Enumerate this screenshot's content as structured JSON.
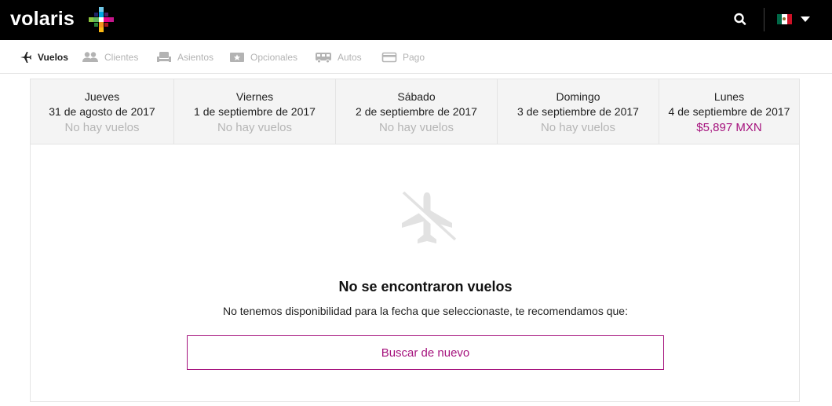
{
  "header": {
    "logo_text": "volaris",
    "icons": {
      "search": "search-icon",
      "flag": "mexico-flag-icon",
      "caret": "chevron-down-icon"
    },
    "colors": {
      "background": "#000000",
      "logo_text": "#ffffff"
    }
  },
  "steps": [
    {
      "label": "Vuelos",
      "icon": "airplane-icon",
      "active": true
    },
    {
      "label": "Clientes",
      "icon": "people-icon",
      "active": false
    },
    {
      "label": "Asientos",
      "icon": "seat-icon",
      "active": false
    },
    {
      "label": "Opcionales",
      "icon": "star-ticket-icon",
      "active": false
    },
    {
      "label": "Autos",
      "icon": "bus-icon",
      "active": false
    },
    {
      "label": "Pago",
      "icon": "credit-card-icon",
      "active": false
    }
  ],
  "dates": [
    {
      "day": "Jueves",
      "date": "31 de agosto de 2017",
      "price": "No hay vuelos",
      "available": false
    },
    {
      "day": "Viernes",
      "date": "1 de septiembre de 2017",
      "price": "No hay vuelos",
      "available": false
    },
    {
      "day": "Sábado",
      "date": "2 de septiembre de 2017",
      "price": "No hay vuelos",
      "available": false
    },
    {
      "day": "Domingo",
      "date": "3 de septiembre de 2017",
      "price": "No hay vuelos",
      "available": false
    },
    {
      "day": "Lunes",
      "date": "4 de septiembre de 2017",
      "price": "$5,897 MXN",
      "available": true
    }
  ],
  "empty_state": {
    "icon": "no-flights-icon",
    "title": "No se encontraron vuelos",
    "message": "No tenemos disponibilidad para la fecha que seleccionaste, te recomendamos que:",
    "button_label": "Buscar de nuevo"
  },
  "colors": {
    "accent": "#a5127d",
    "muted": "#b5b5b5",
    "panel": "#f4f4f4"
  }
}
